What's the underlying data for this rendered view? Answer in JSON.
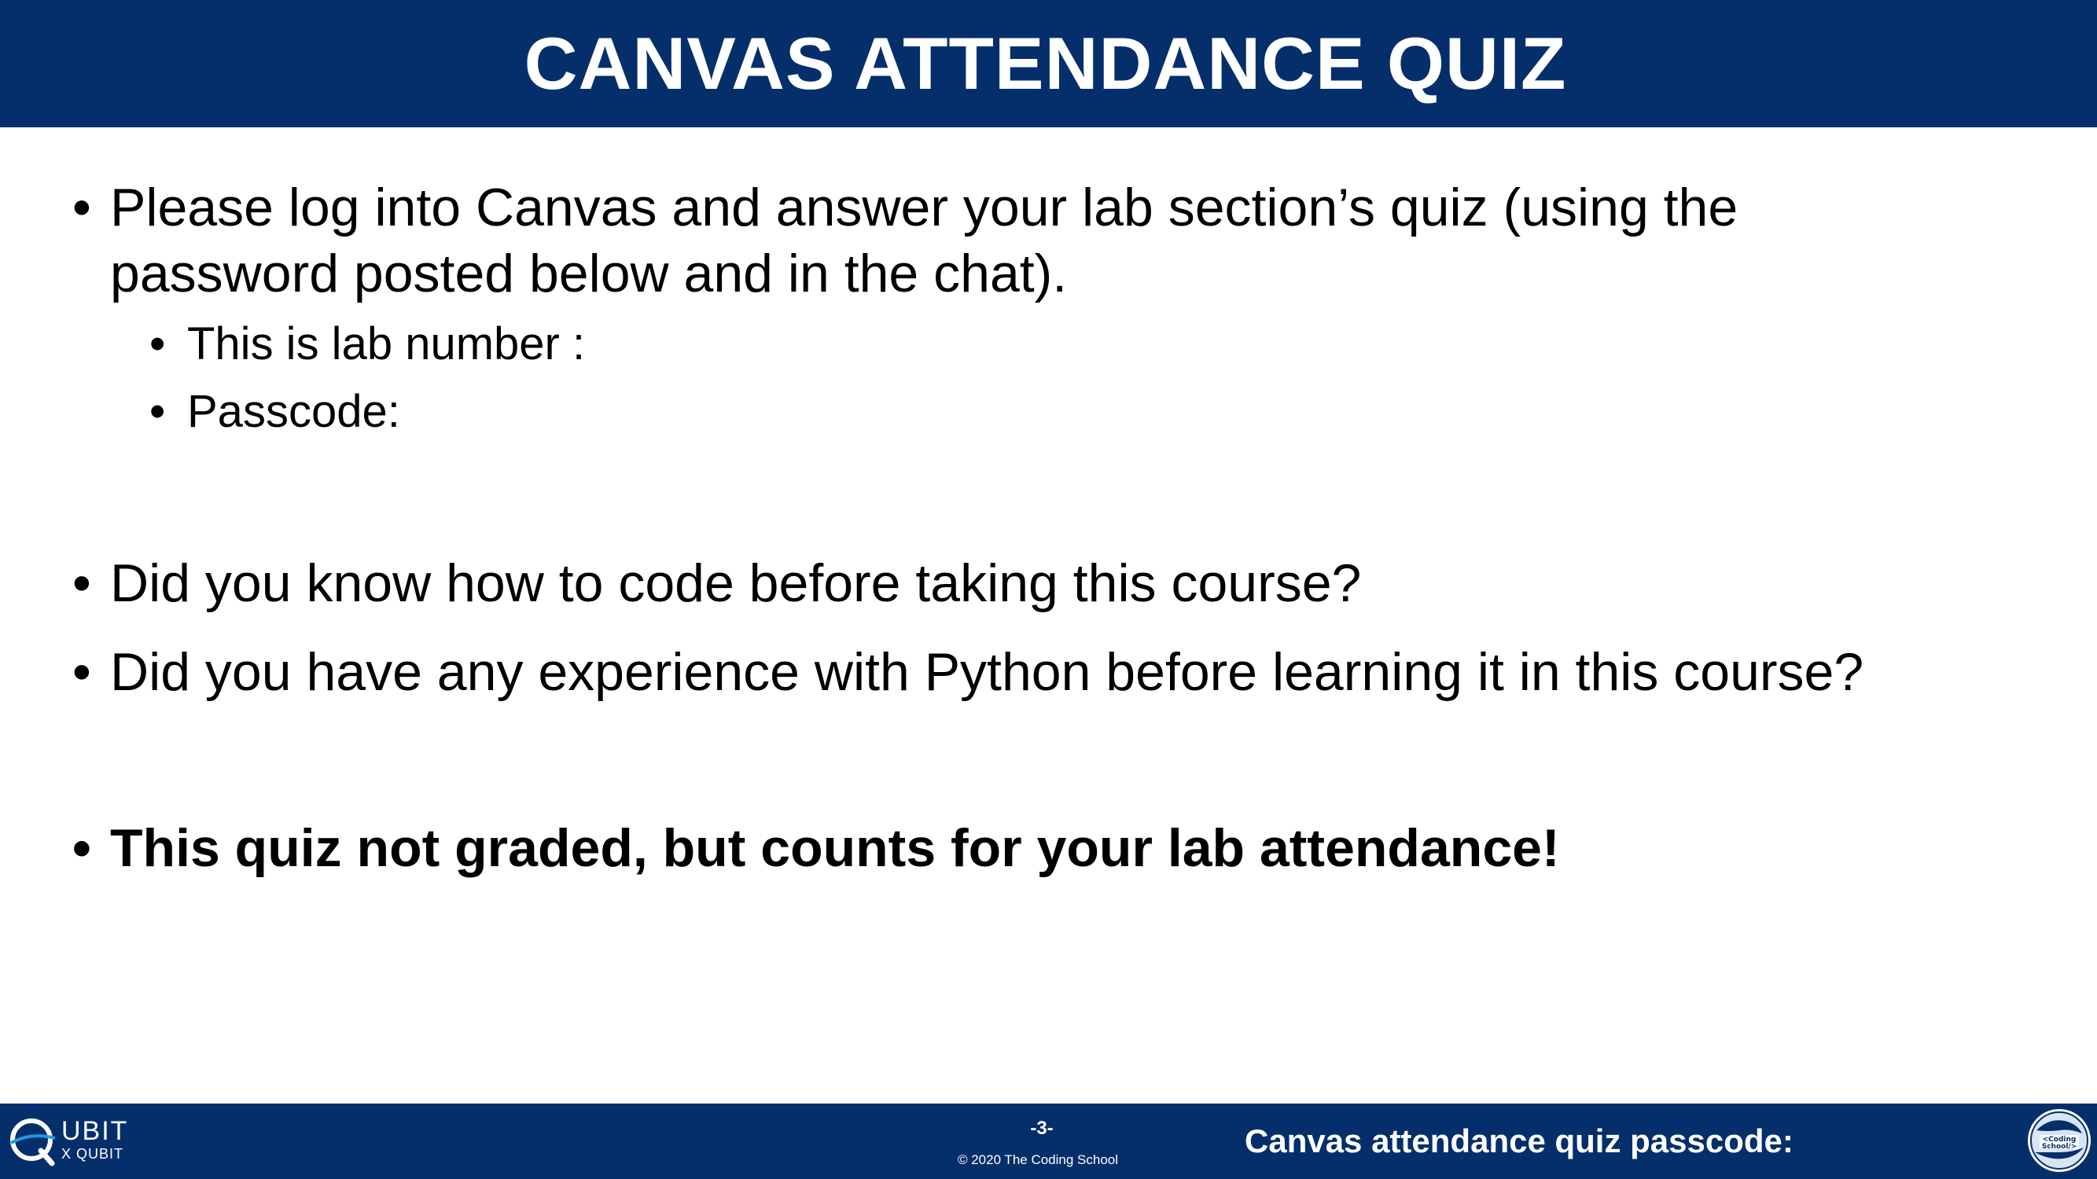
{
  "header": {
    "title": "CANVAS ATTENDANCE QUIZ"
  },
  "bullets": {
    "bullet_glyph": "•",
    "item1": "Please log into Canvas and answer your lab section’s quiz (using the password posted below and in the chat).",
    "sub1": "This is lab number :",
    "sub2": "Passcode:",
    "item2": "Did you know how to code before taking this course?",
    "item3": "Did you have any experience with Python before learning it in this course?",
    "item4": "This quiz not graded, but counts for your lab attendance!"
  },
  "footer": {
    "logo_left": {
      "main": "UBIT",
      "sub": "X QUBIT",
      "icon": "qubit-logo-icon"
    },
    "page_number": "-3-",
    "copyright": "© 2020 The Coding School",
    "passcode_label": "Canvas attendance quiz passcode:",
    "logo_right": {
      "icon": "coding-school-logo-icon",
      "text_line1": "<Coding",
      "text_line2": "School/>"
    }
  },
  "colors": {
    "brand_navy": "#052f6b",
    "text": "#000000",
    "background": "#ffffff"
  }
}
